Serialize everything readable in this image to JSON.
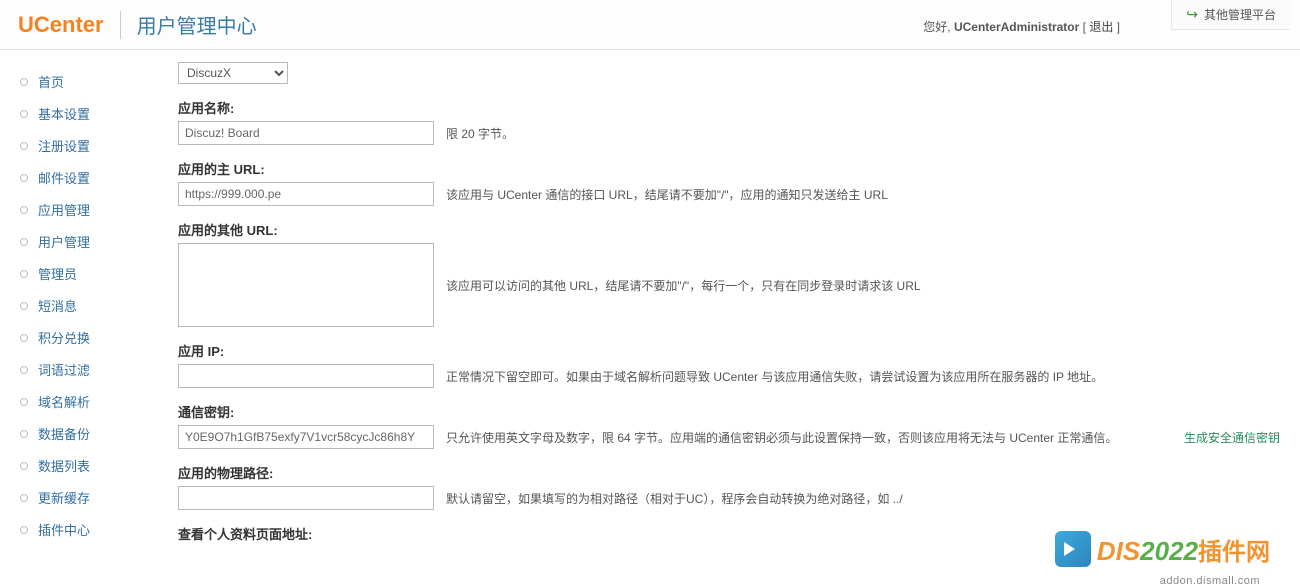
{
  "header": {
    "logo_u": "U",
    "logo_center": "Center",
    "subtitle": "用户管理中心",
    "greeting": "您好, ",
    "username": "UCenterAdministrator",
    "logout_l": " [ ",
    "logout": "退出",
    "logout_r": " ]",
    "other_platform": "其他管理平台"
  },
  "sidebar": {
    "items": [
      "首页",
      "基本设置",
      "注册设置",
      "邮件设置",
      "应用管理",
      "用户管理",
      "管理员",
      "短消息",
      "积分兑换",
      "词语过滤",
      "域名解析",
      "数据备份",
      "数据列表",
      "更新缓存",
      "插件中心"
    ]
  },
  "form": {
    "select_value": "DiscuzX",
    "app_name_label": "应用名称:",
    "app_name_value": "Discuz! Board",
    "app_name_hint": "限 20 字节。",
    "main_url_label": "应用的主 URL:",
    "main_url_value": "https://999.000.pe",
    "main_url_hint": "该应用与 UCenter 通信的接口 URL，结尾请不要加\"/\"，应用的通知只发送给主 URL",
    "other_url_label": "应用的其他 URL:",
    "other_url_value": "",
    "other_url_hint": "该应用可以访问的其他 URL，结尾请不要加\"/\"，每行一个，只有在同步登录时请求该 URL",
    "ip_label": "应用 IP:",
    "ip_value": "",
    "ip_hint": "正常情况下留空即可。如果由于域名解析问题导致 UCenter 与该应用通信失败，请尝试设置为该应用所在服务器的 IP 地址。",
    "key_label": "通信密钥:",
    "key_value": "Y0E9O7h1GfB75exfy7V1vcr58cycJc86h8Y",
    "key_hint": "只允许使用英文字母及数字，限 64 字节。应用端的通信密钥必须与此设置保持一致，否则该应用将无法与 UCenter 正常通信。",
    "key_gen": "生成安全通信密钥",
    "path_label": "应用的物理路径:",
    "path_value": "",
    "path_hint": "默认请留空，如果填写的为相对路径（相对于UC），程序会自动转换为绝对路径，如 ../",
    "profile_label": "查看个人资料页面地址:"
  },
  "watermark": {
    "t1": "D",
    "t2": "IS",
    "t3": "2022",
    "t4": "插件网",
    "sub": "addon.dismall.com"
  }
}
